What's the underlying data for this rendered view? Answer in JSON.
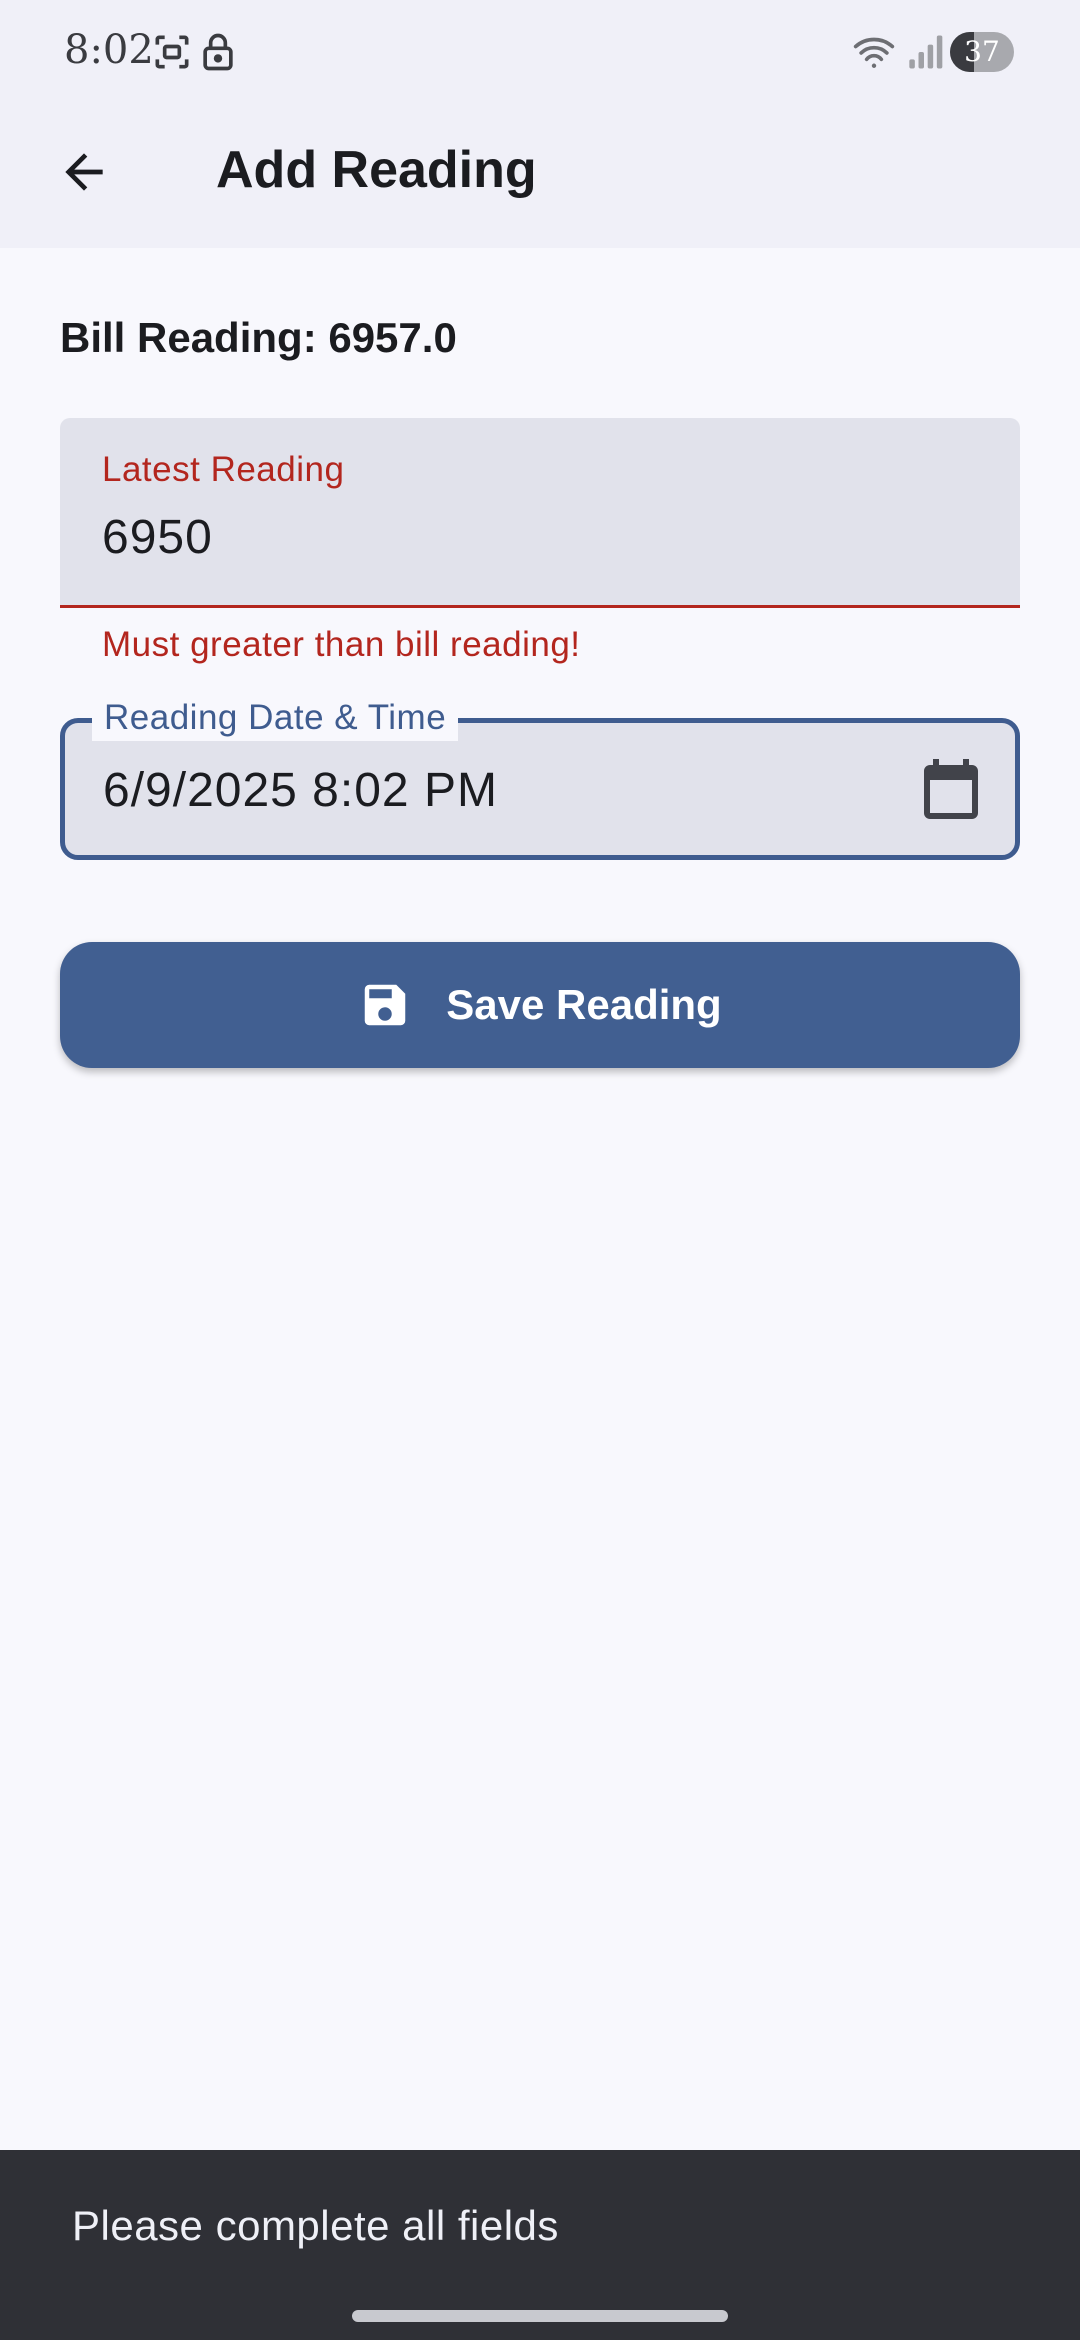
{
  "status_bar": {
    "time": "8:02",
    "battery": "37",
    "battery_level": 0.37,
    "icons": [
      "screenshot-icon",
      "lock-icon",
      "wifi-icon",
      "signal-icon",
      "battery-icon"
    ]
  },
  "app_bar": {
    "title": "Add Reading",
    "back_icon": "arrow-back-icon"
  },
  "form": {
    "bill_reading_text": "Bill Reading: 6957.0",
    "latest_reading": {
      "label": "Latest Reading",
      "value": "6950",
      "error": "Must greater than bill reading!"
    },
    "reading_datetime": {
      "label": "Reading Date & Time",
      "value": "6/9/2025 8:02 PM",
      "icon": "calendar-icon"
    },
    "save_button": {
      "label": "Save Reading",
      "icon": "save-icon"
    }
  },
  "snackbar": {
    "message": "Please complete all fields"
  },
  "colors": {
    "primary": "#415f91",
    "error": "#b3261e",
    "field_fill": "#e1e2eb",
    "background": "#f8f8fd",
    "app_bar": "#f0f0f8",
    "snackbar": "#2f3036"
  }
}
